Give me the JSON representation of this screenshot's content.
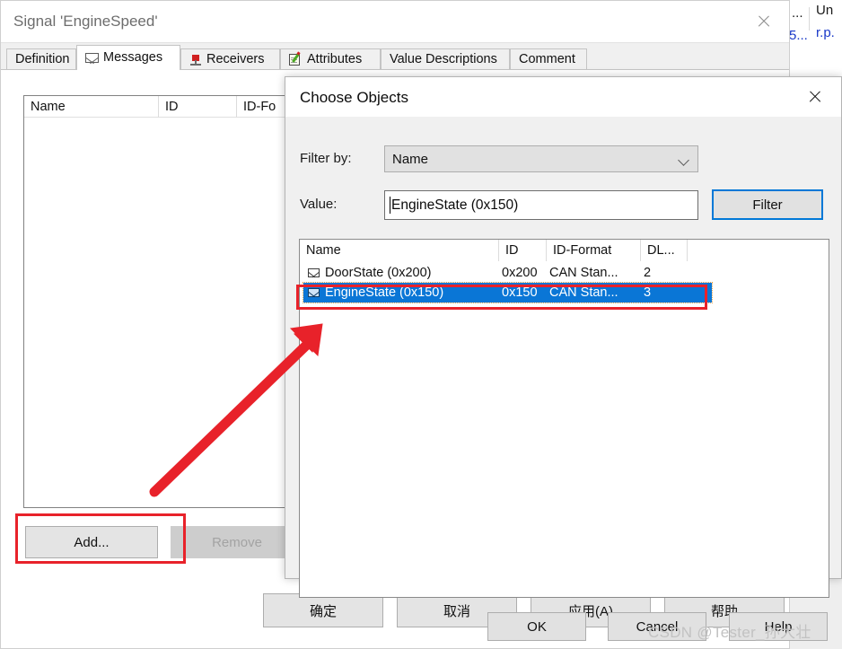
{
  "background_window": {
    "col_text": "...",
    "header_text": "Un",
    "link_dots": "5...",
    "link_text": "r.p."
  },
  "main_window": {
    "title": "Signal 'EngineSpeed'",
    "close_icon": "close-icon",
    "tabs": [
      {
        "label": "Definition",
        "icon": "",
        "active": false
      },
      {
        "label": "Messages",
        "icon": "envelope-icon",
        "active": true
      },
      {
        "label": "Receivers",
        "icon": "pin-icon",
        "active": false
      },
      {
        "label": "Attributes",
        "icon": "attribute-pencil-icon",
        "active": false
      },
      {
        "label": "Value Descriptions",
        "icon": "",
        "active": false
      },
      {
        "label": "Comment",
        "icon": "",
        "active": false
      }
    ],
    "message_list": {
      "columns": [
        "Name",
        "ID",
        "ID-Fo"
      ],
      "rows": []
    },
    "buttons": {
      "add": "Add...",
      "remove": "Remove"
    },
    "footer_buttons": [
      "确定",
      "取消",
      "应用(A)",
      "帮助"
    ]
  },
  "dialog": {
    "title": "Choose Objects",
    "close_icon": "close-icon",
    "filter_by_label": "Filter by:",
    "filter_by_value": "Name",
    "value_label": "Value:",
    "value_text": "EngineState (0x150)",
    "filter_button": "Filter",
    "list": {
      "columns": [
        "Name",
        "ID",
        "ID-Format",
        "DL..."
      ],
      "rows": [
        {
          "icon": "envelope-icon",
          "name": "DoorState (0x200)",
          "id": "0x200",
          "id_format": "CAN Stan...",
          "dlc": "2",
          "selected": false
        },
        {
          "icon": "envelope-icon",
          "name": "EngineState (0x150)",
          "id": "0x150",
          "id_format": "CAN Stan...",
          "dlc": "3",
          "selected": true
        }
      ]
    },
    "buttons": {
      "ok": "OK",
      "cancel": "Cancel",
      "help": "Help"
    }
  },
  "annotations": {
    "highlight_color": "#e8222a",
    "arrow_color": "#e8222a",
    "boxes": [
      "add-button-highlight",
      "selected-row-highlight"
    ]
  },
  "watermark": "CSDN @Tester_孙大壮"
}
